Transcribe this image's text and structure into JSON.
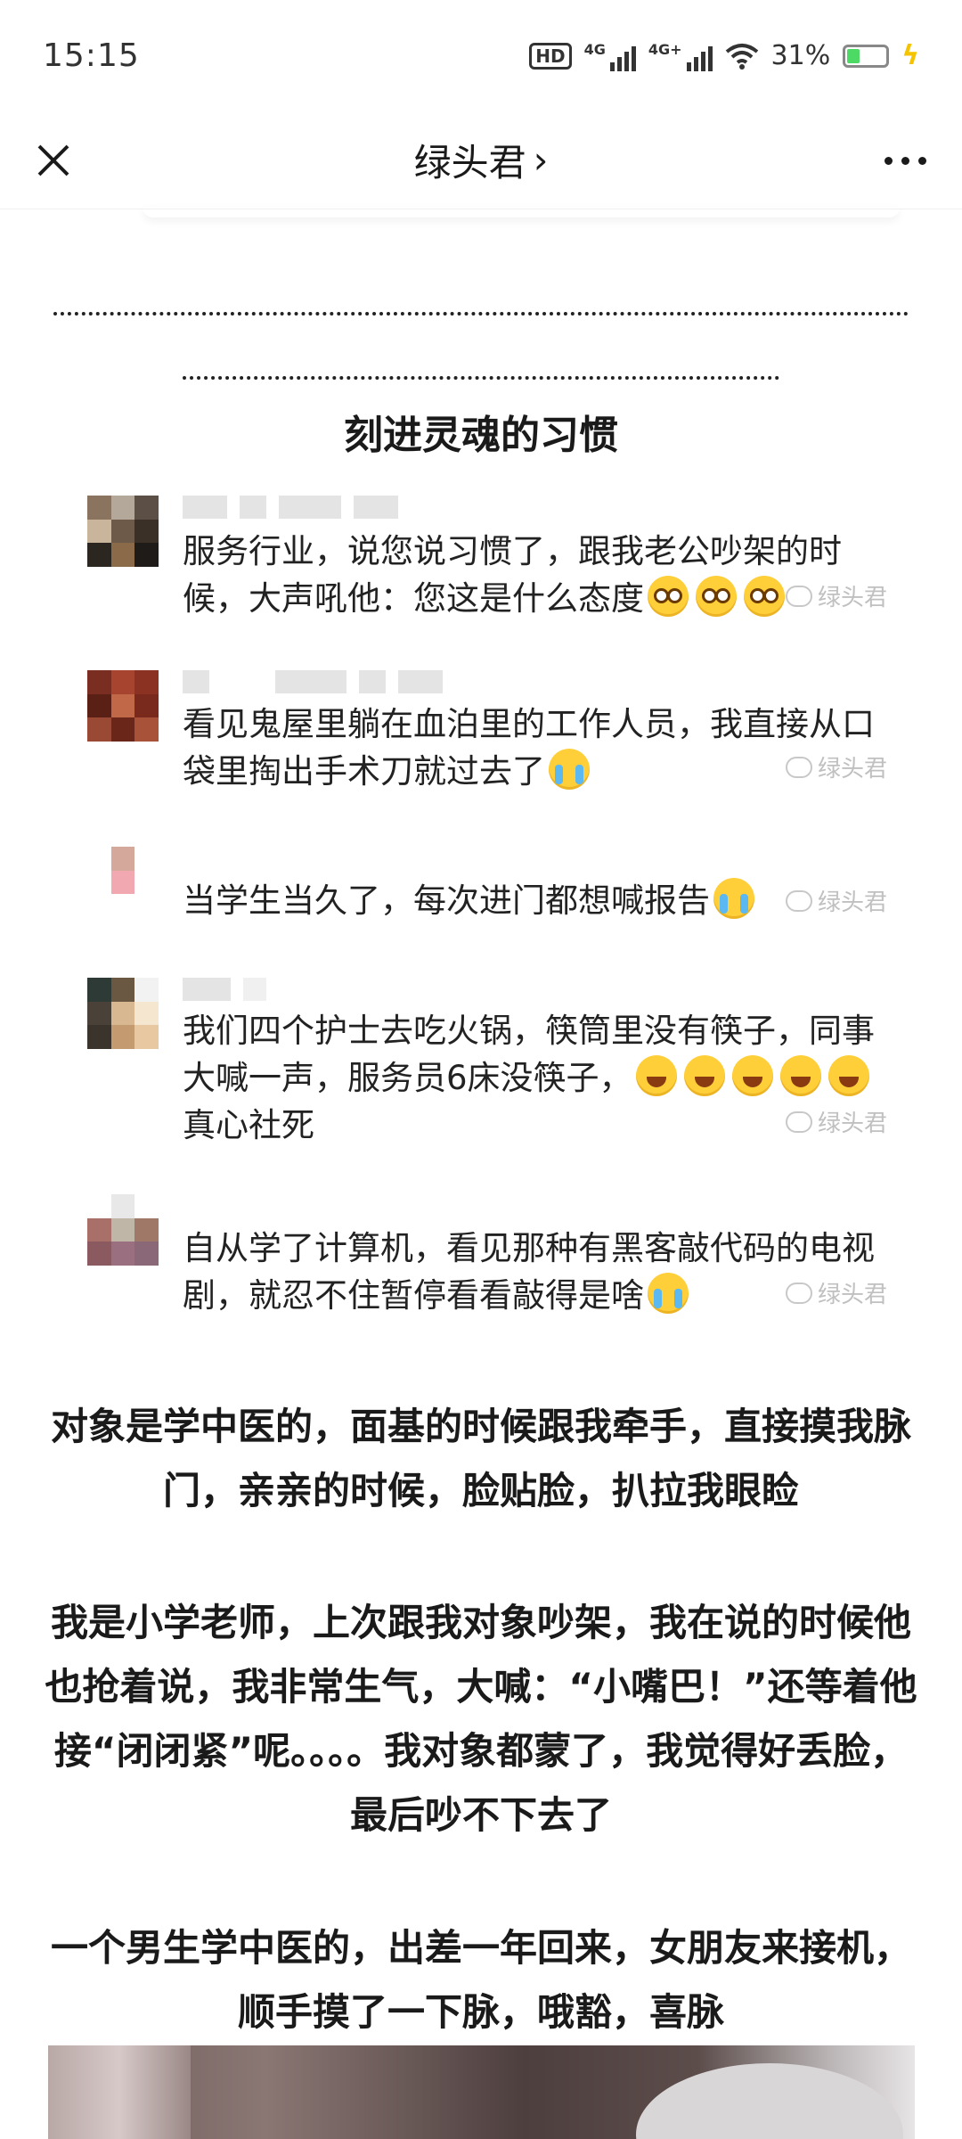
{
  "status_bar": {
    "time": "15:15",
    "hd_label": "HD",
    "network1": "4G",
    "network2": "4G+",
    "battery_text": "31%",
    "battery_level": 0.31
  },
  "nav": {
    "title": "绿头君",
    "title_chevron": "›"
  },
  "article": {
    "section_title": "刻进灵魂的习惯",
    "watermark": "绿头君",
    "comments": [
      {
        "text": "服务行业，说您说习惯了，跟我老公吵架的时候，大声吼他：您这是什么态度"
      },
      {
        "text": "看见鬼屋里躺在血泊里的工作人员，我直接从口袋里掏出手术刀就过去了"
      },
      {
        "text": "当学生当久了，每次进门都想喊报告"
      },
      {
        "text": "我们四个护士去吃火锅，筷筒里没有筷子，同事大喊一声，服务员6床没筷子，",
        "text2": "真心社死"
      },
      {
        "text": "自从学了计算机，看见那种有黑客敲代码的电视剧，就忍不住暂停看看敲得是啥"
      }
    ],
    "paragraphs": [
      "对象是学中医的，面基的时候跟我牵手，直接摸我脉门，亲亲的时候，脸贴脸，扒拉我眼睑",
      "我是小学老师，上次跟我对象吵架，我在说的时候他也抢着说，我非常生气，大喊：“小嘴巴！”还等着他接“闭闭紧”呢。。。。我对象都蒙了，我觉得好丢脸，最后吵不下去了",
      "一个男生学中医的，出差一年回来，女朋友来接机，顺手摸了一下脉，哦豁，喜脉"
    ]
  },
  "colors": {
    "emoji": "#ffcf3a",
    "battery": "#4cd964",
    "charge": "#f5c400",
    "watermark": "#c0c0c0"
  },
  "icons": [
    "close-icon",
    "more-icon",
    "wifi-icon",
    "signal-icon",
    "battery-icon",
    "charging-icon",
    "wechat-watermark-icon"
  ]
}
